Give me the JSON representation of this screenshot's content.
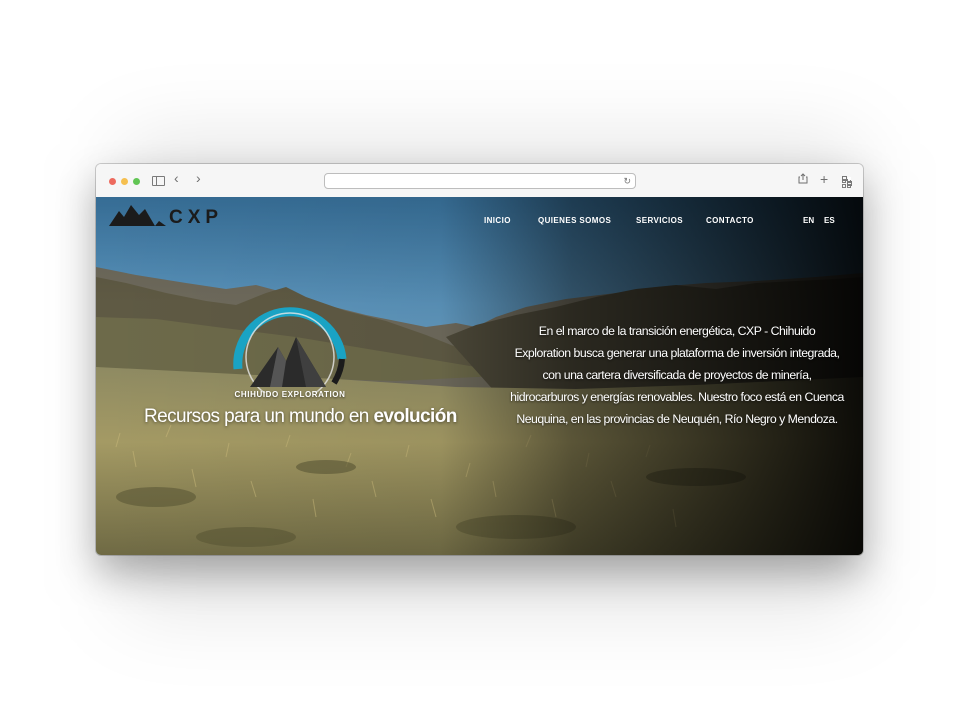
{
  "brand": {
    "logo_text": "CXP"
  },
  "nav": {
    "items": [
      {
        "label": "INICIO"
      },
      {
        "label": "QUIENES SOMOS"
      },
      {
        "label": "SERVICIOS"
      },
      {
        "label": "CONTACTO"
      }
    ],
    "languages": [
      "EN",
      "ES"
    ]
  },
  "hero": {
    "emblem_label": "CHIHUIDO EXPLORATION",
    "tagline_prefix": "Recursos para un mundo en ",
    "tagline_emphasis": "evolución",
    "description": "En el marco de la transición energética, CXP - Chihuido Exploration busca generar una plataforma de inversión integrada, con una cartera diversificada de proyectos de minería, hidrocarburos y energías renovables. Nuestro foco está en Cuenca Neuquina, en las provincias de Neuquén, Río Negro y Mendoza."
  },
  "browser": {
    "url_value": "",
    "icons": [
      "sidebar-icon",
      "back-icon",
      "forward-icon",
      "reload-icon",
      "share-icon",
      "new-tab-icon",
      "tab-overview-icon"
    ]
  },
  "colors": {
    "emblem_accent": "#1aa3c4",
    "logo_dark": "#1b1b1b"
  }
}
